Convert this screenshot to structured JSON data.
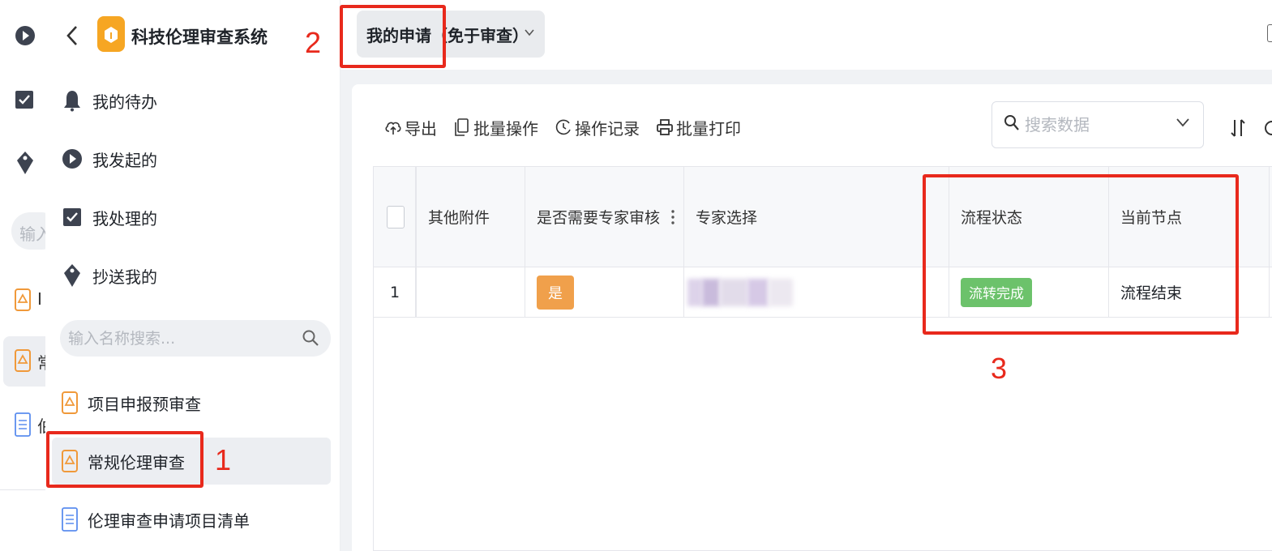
{
  "rail": {
    "search_placeholder": "输入",
    "item_text_1": "I",
    "item_text_2": "常",
    "item_text_3": "伯"
  },
  "sidebar": {
    "app_title": "科技伦理审查系统",
    "nav": [
      {
        "label": "我的待办",
        "icon": "bell-icon"
      },
      {
        "label": "我发起的",
        "icon": "play-circle-icon"
      },
      {
        "label": "我处理的",
        "icon": "checkbox-icon"
      },
      {
        "label": "抄送我的",
        "icon": "tag-icon"
      }
    ],
    "search_placeholder": "输入名称搜索...",
    "menu": [
      {
        "label": "项目申报预审查",
        "icon": "form-app-icon"
      },
      {
        "label": "常规伦理审查",
        "icon": "form-app-icon",
        "active": true
      },
      {
        "label": "伦理审查申请项目清单",
        "icon": "document-icon"
      }
    ]
  },
  "topbar": {
    "view_label": "我的申请（免于审查）"
  },
  "toolbar": {
    "export_label": "导出",
    "batch_label": "批量操作",
    "history_label": "操作记录",
    "print_label": "批量打印",
    "search_placeholder": "搜索数据"
  },
  "table": {
    "columns": [
      "其他附件",
      "是否需要专家审核",
      "专家选择",
      "流程状态",
      "当前节点"
    ],
    "rows": [
      {
        "index": "1",
        "attachments": "",
        "need_expert": "是",
        "expert": "",
        "status": "流转完成",
        "node": "流程结束"
      }
    ]
  },
  "annotations": [
    "1",
    "2",
    "3"
  ],
  "colors": {
    "accent_red": "#e8291c",
    "logo_orange": "#f6a623",
    "tag_orange": "#f0a04b",
    "tag_green": "#6cc26b"
  }
}
